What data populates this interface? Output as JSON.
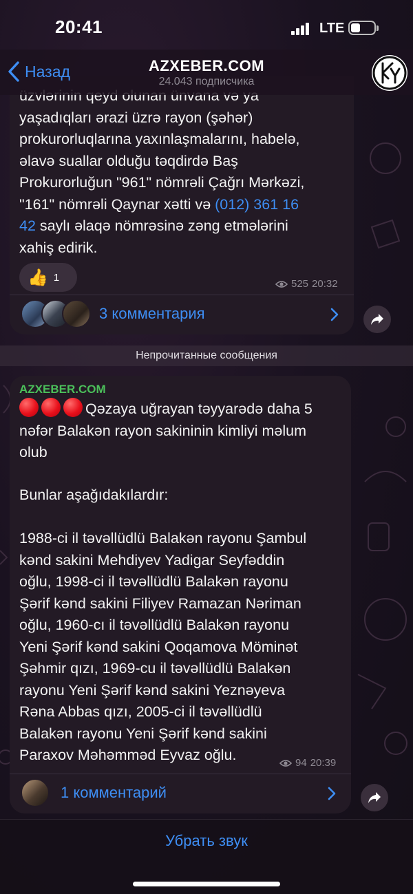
{
  "status_bar": {
    "time": "20:41",
    "network": "LTE",
    "icons": [
      "signal-icon",
      "battery-icon"
    ]
  },
  "header": {
    "back_label": "Назад",
    "title": "AZXEBER.COM",
    "subtitle": "24.043 подписчика",
    "accent_color": "#3e8ef4"
  },
  "message_1": {
    "text_before_link": "üzvlərinin qeyd olunan ünvana və ya\nyaşadıqları ərazi üzrə rayon (şəhər)\nprokurorluqlarına yaxınlaşmalarını, habelə,\nəlavə suallar olduğu təqdirdə Baş\nProkurorluğun \"961\" nömrəli Çağrı Mərkəzi,\n\"161\" nömrəli Qaynar xətti və ",
    "link_text": "(012) 361 16\n42",
    "text_after_link": " saylı əlaqə nömrəsinə zəng etmələrini\nxahiş edirik.",
    "reaction_emoji": "👍",
    "reaction_count": "1",
    "views": "525",
    "time": "20:32",
    "comments_label": "3 комментария"
  },
  "unread_divider": "Непрочитанные сообщения",
  "message_2": {
    "sender": "AZXEBER.COM",
    "headline": "Qəzaya uğrayan təyyarədə daha 5\nnəfər Balakən rayon sakininin kimliyi məlum\nolub",
    "intro": "Bunlar aşağıdakılardır:",
    "body": "1988-ci il təvəllüdlü Balakən rayonu Şambul\nkənd sakini Mehdiyev Yadigar Seyfəddin\noğlu, 1998-ci il təvəllüdlü Balakən rayonu\nŞərif kənd sakini Filiyev Ramazan Nəriman\noğlu, 1960-cı il təvəllüdlü Balakən rayonu\nYeni Şərif kənd sakini Qoqamova Möminət\nŞəhmir qızı, 1969-cu il təvəllüdlü Balakən\nrayonu Yeni Şərif kənd sakini Yeznəyeva\nRəna Abbas qızı, 2005-ci il təvəllüdlü\nBalakən rayonu Yeni Şərif kənd sakini\nParaxov Məhəmməd Eyvaz oğlu.",
    "views": "94",
    "time": "20:39",
    "comments_label": "1 комментарий",
    "sender_color": "#4bbf5a"
  },
  "bottom": {
    "mute_label": "Убрать звук"
  }
}
